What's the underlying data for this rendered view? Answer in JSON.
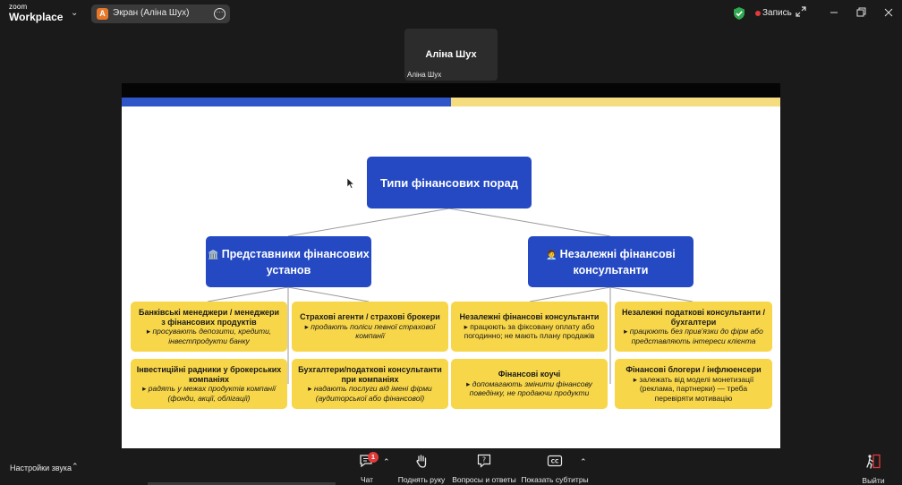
{
  "app": {
    "logo_top": "zoom",
    "logo_bottom": "Workplace",
    "share_avatar_letter": "A",
    "share_label": "Экран (Аліна Шух)",
    "recording_label": "Запись",
    "colors": {
      "record": "#e03a3a",
      "shield": "#2fa84f",
      "avatar": "#e8772a"
    }
  },
  "participant": {
    "name": "Аліна Шух",
    "caption": "Аліна Шух"
  },
  "slide": {
    "colors": {
      "blue": "#2549c2",
      "band_blue": "#2f55c9",
      "band_yellow": "#f5dc7e",
      "card": "#f7d64a"
    },
    "root": "Типи фінансових порад",
    "left": {
      "emoji": "🏛️",
      "title": "Представники фінансових установ"
    },
    "right": {
      "emoji": "🧑‍💼",
      "title": "Незалежні фінансові консультанти"
    },
    "cards": [
      {
        "title": "Банківські менеджери / менеджери з фінансових продуктів",
        "desc": "▸ просувають депозити, кредити, інвестпродукти банку"
      },
      {
        "title": "Страхові агенти / страхові брокери",
        "desc": "▸ продають поліси певної страхової компанії"
      },
      {
        "title": "Незалежні фінансові консультанти",
        "desc": "▸ працюють за фіксовану оплату або погодинно; не мають плану продажів"
      },
      {
        "title": "Незалежні податкові консультанти / бухгалтери",
        "desc": "▸ працюють без прив'язки до фірм або представляють інтереси клієнта"
      },
      {
        "title": "Інвестиційні радники у брокерських компаніях",
        "desc": "▸ радять у межах продуктів компанії (фонди, акції, облігації)"
      },
      {
        "title": "Бухгалтери/податкові консультанти при компаніях",
        "desc": "▸ надають послуги від імені фірми (аудиторської або фінансової)"
      },
      {
        "title": "Фінансові коучі",
        "desc": "▸ допомагають змінити фінансову поведінку, не продаючи продукти"
      },
      {
        "title": "Фінансові блогери / інфлюенсери",
        "desc": "▸ залежать від моделі монетизації (реклама, партнерки) — треба перевіряти мотивацію"
      }
    ]
  },
  "toolbar": {
    "audio_settings": "Настройки звука",
    "chat": "Чат",
    "chat_badge": "1",
    "raise_hand": "Поднять руку",
    "qa": "Вопросы и ответы",
    "captions": "Показать субтитры",
    "cc_text": "CC",
    "leave": "Выйти"
  }
}
